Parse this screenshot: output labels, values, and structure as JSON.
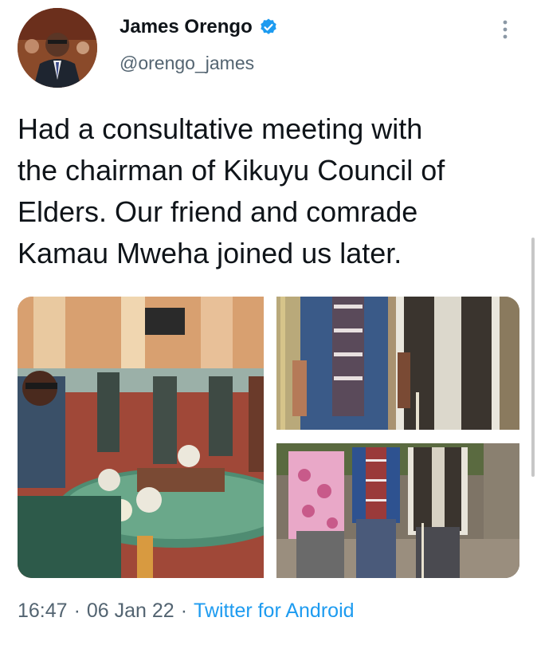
{
  "author": {
    "name": "James Orengo",
    "handle": "@orengo_james",
    "verified_icon": "verified-badge-icon",
    "avatar_icon": "profile-photo"
  },
  "tweet": {
    "lines": [
      "Had a consultative meeting with",
      "the chairman of Kikuyu Council of",
      "Elders. Our friend and comrade",
      "Kamau Mweha joined us later."
    ]
  },
  "media": {
    "photos": [
      "dining-room-photo",
      "two-men-standing-photo",
      "three-men-standing-photo"
    ]
  },
  "meta": {
    "time": "16:47",
    "separator": "·",
    "date": "06 Jan 22",
    "source": "Twitter for Android"
  },
  "colors": {
    "link": "#1d9bf0",
    "secondary_text": "#536471",
    "verified": "#1d9bf0"
  }
}
